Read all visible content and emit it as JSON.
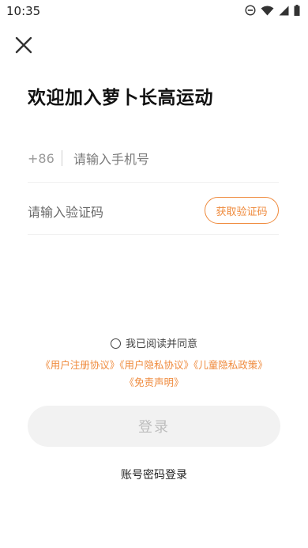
{
  "status_bar": {
    "time": "10:35"
  },
  "header": {
    "title": "欢迎加入萝卜长高运动"
  },
  "phone": {
    "country_code": "+86",
    "placeholder": "请输入手机号"
  },
  "code": {
    "placeholder": "请输入验证码",
    "get_code_label": "获取验证码"
  },
  "agreement": {
    "prefix": "我已阅读并同意",
    "links": [
      "《用户注册协议》",
      "《用户隐私协议》",
      "《儿童隐私政策》",
      "《免责声明》"
    ]
  },
  "login_label": "登录",
  "password_login_label": "账号密码登录",
  "colors": {
    "accent": "#ef8a3c",
    "button_bg": "#f2f2f2",
    "button_text": "#bdbdbd"
  },
  "icons": [
    "close-icon",
    "dnd-icon",
    "wifi-icon",
    "signal-icon",
    "battery-icon",
    "radio-icon"
  ]
}
